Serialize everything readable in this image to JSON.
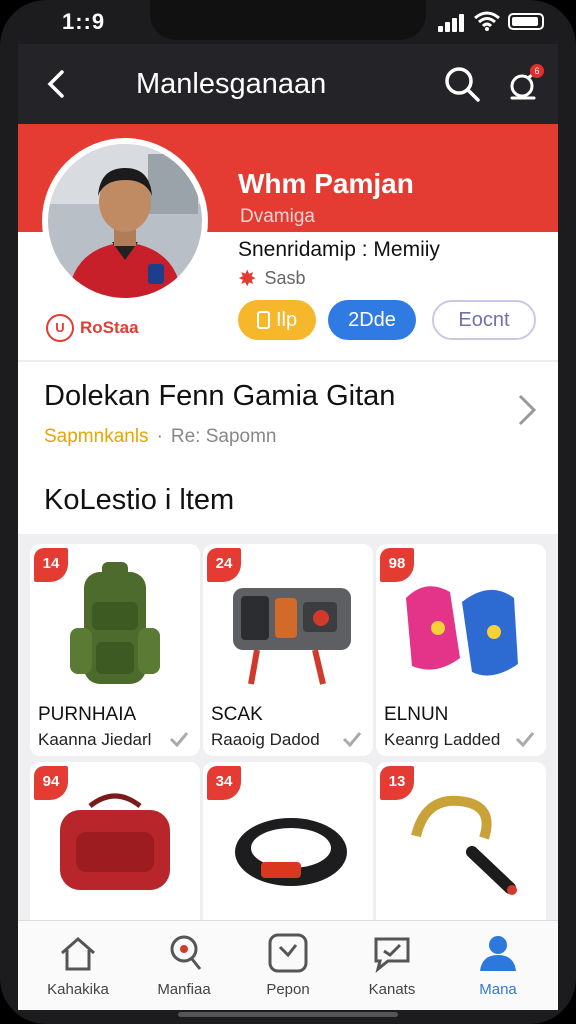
{
  "status_bar": {
    "time": "1::9"
  },
  "header": {
    "title": "Manlesganaan",
    "badge": "6"
  },
  "profile": {
    "name": "Whm Pamjan",
    "role": "Dvamiga",
    "stat": "Snenridamip : Memiiy",
    "sub": "Sasb",
    "club": "RoStaa",
    "club_logo_text": "U",
    "buttons": {
      "primary": "Ilp",
      "secondary": "2Dde",
      "tertiary": "Eocnt"
    }
  },
  "game": {
    "title": "Dolekan Fenn Gamia Gitan",
    "tag": "Sapmnkanls",
    "meta": "Re: Sapomn"
  },
  "collection": {
    "title": "KoLestio i ltem",
    "items": [
      {
        "rank": "14",
        "name": "PURNHAIA",
        "status": "Kaanna Jiedarl",
        "icon": "backpack"
      },
      {
        "rank": "24",
        "name": "SCAK",
        "status": "Raaoig Dadod",
        "icon": "device"
      },
      {
        "rank": "98",
        "name": "ELNUN",
        "status": "Keanrg Ladded",
        "icon": "sneakers"
      },
      {
        "rank": "94",
        "name": "",
        "status": "",
        "icon": "bag"
      },
      {
        "rank": "34",
        "name": "",
        "status": "",
        "icon": "band"
      },
      {
        "rank": "13",
        "name": "",
        "status": "",
        "icon": "horseshoe-bat"
      }
    ]
  },
  "nav": [
    {
      "label": "Kahakika",
      "icon": "home-icon"
    },
    {
      "label": "Manfiaa",
      "icon": "map-pin-icon"
    },
    {
      "label": "Pepon",
      "icon": "clock-icon"
    },
    {
      "label": "Kanats",
      "icon": "chat-icon"
    },
    {
      "label": "Mana",
      "icon": "profile-icon"
    }
  ],
  "colors": {
    "accent_red": "#e43c32",
    "blue": "#2f7be3",
    "yellow": "#f6b72a"
  }
}
